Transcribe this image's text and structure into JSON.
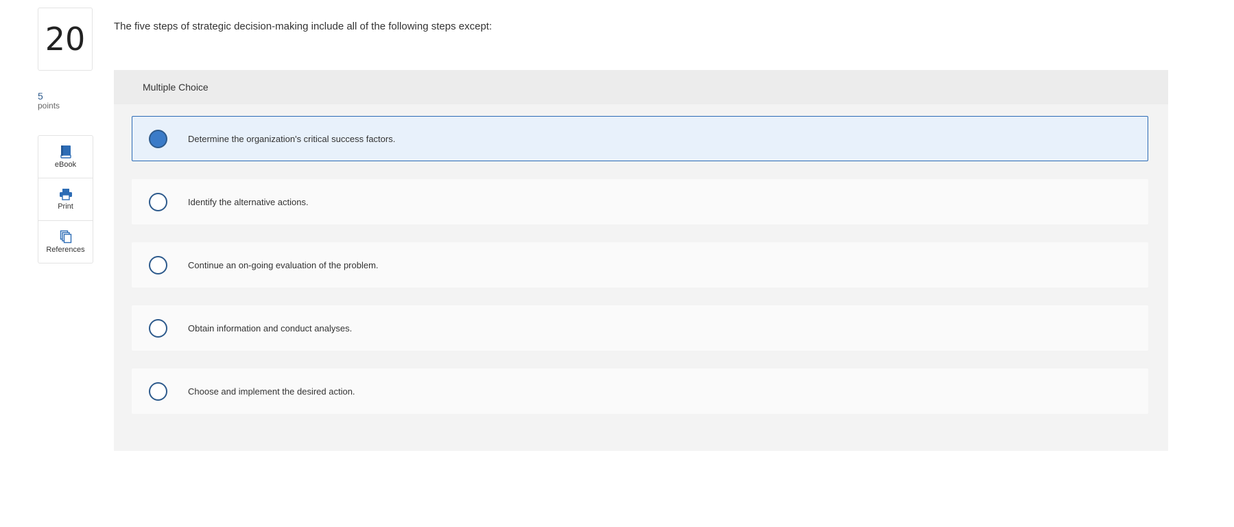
{
  "question": {
    "number": "20",
    "points_value": "5",
    "points_label": "points",
    "text": "The five steps of strategic decision-making include all of the following steps except:"
  },
  "tools": [
    {
      "label": "eBook",
      "icon": "book-icon"
    },
    {
      "label": "Print",
      "icon": "printer-icon"
    },
    {
      "label": "References",
      "icon": "copy-icon"
    }
  ],
  "multiple_choice": {
    "header": "Multiple Choice",
    "selected_index": 0,
    "options": [
      {
        "text": "Determine the organization's critical success factors."
      },
      {
        "text": "Identify the alternative actions."
      },
      {
        "text": "Continue an on-going evaluation of the problem."
      },
      {
        "text": "Obtain information and conduct analyses."
      },
      {
        "text": "Choose and implement the desired action."
      }
    ]
  },
  "colors": {
    "accent": "#2d5a8c",
    "selected_fill": "#3a7bc8",
    "selected_bg": "#e8f1fb"
  }
}
